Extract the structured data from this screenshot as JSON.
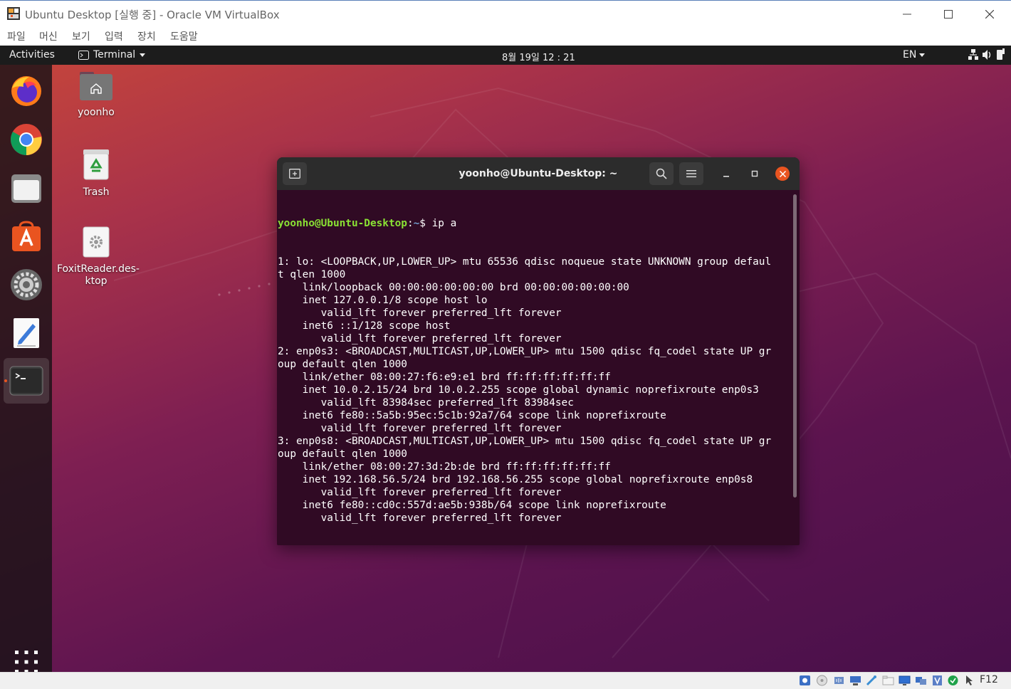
{
  "vbox": {
    "title": "Ubuntu Desktop [실행 중] - Oracle VM VirtualBox",
    "menu": [
      "파일",
      "머신",
      "보기",
      "입력",
      "장치",
      "도움말"
    ],
    "host_key": "F12"
  },
  "topbar": {
    "activities": "Activities",
    "app_menu": "Terminal",
    "clock": "8월 19일  12 : 21",
    "language": "EN"
  },
  "dock": {
    "items": [
      "firefox",
      "chrome",
      "files",
      "software-center",
      "settings",
      "text-editor",
      "terminal"
    ],
    "active": "terminal"
  },
  "desktop": {
    "icons": [
      {
        "label": "yoonho",
        "icon": "home-folder-icon"
      },
      {
        "label": "Trash",
        "icon": "trash-icon"
      },
      {
        "label_lines": [
          "FoxitReader.des-",
          "ktop"
        ],
        "icon": "desktop-file-icon"
      }
    ]
  },
  "terminal": {
    "title": "yoonho@Ubuntu-Desktop: ~",
    "prompt_user": "yoonho@Ubuntu-Desktop",
    "prompt_path": "~",
    "command": "ip a",
    "output": [
      "1: lo: <LOOPBACK,UP,LOWER_UP> mtu 65536 qdisc noqueue state UNKNOWN group defaul",
      "t qlen 1000",
      "    link/loopback 00:00:00:00:00:00 brd 00:00:00:00:00:00",
      "    inet 127.0.0.1/8 scope host lo",
      "       valid_lft forever preferred_lft forever",
      "    inet6 ::1/128 scope host",
      "       valid_lft forever preferred_lft forever",
      "2: enp0s3: <BROADCAST,MULTICAST,UP,LOWER_UP> mtu 1500 qdisc fq_codel state UP gr",
      "oup default qlen 1000",
      "    link/ether 08:00:27:f6:e9:e1 brd ff:ff:ff:ff:ff:ff",
      "    inet 10.0.2.15/24 brd 10.0.2.255 scope global dynamic noprefixroute enp0s3",
      "       valid_lft 83984sec preferred_lft 83984sec",
      "    inet6 fe80::5a5b:95ec:5c1b:92a7/64 scope link noprefixroute",
      "       valid_lft forever preferred_lft forever",
      "3: enp0s8: <BROADCAST,MULTICAST,UP,LOWER_UP> mtu 1500 qdisc fq_codel state UP gr",
      "oup default qlen 1000",
      "    link/ether 08:00:27:3d:2b:de brd ff:ff:ff:ff:ff:ff",
      "    inet 192.168.56.5/24 brd 192.168.56.255 scope global noprefixroute enp0s8",
      "       valid_lft forever preferred_lft forever",
      "    inet6 fe80::cd0c:557d:ae5b:938b/64 scope link noprefixroute",
      "       valid_lft forever preferred_lft forever"
    ]
  },
  "colors": {
    "prompt_user": "#8ae234",
    "prompt_path": "#729fcf",
    "terminal_bg": "#300a24",
    "accent": "#e95420"
  }
}
